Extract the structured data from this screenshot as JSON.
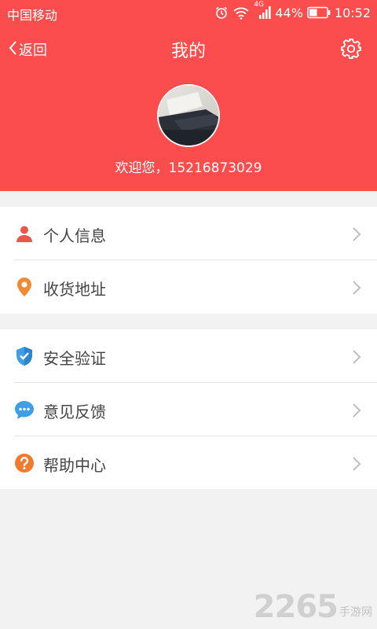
{
  "status_bar": {
    "carrier": "中国移动",
    "network": "4G",
    "battery": "44%",
    "time": "10:52"
  },
  "nav": {
    "back_label": "返回",
    "title": "我的",
    "settings_icon": "gear-icon"
  },
  "profile": {
    "welcome": "欢迎您，15216873029"
  },
  "menu_group_1": [
    {
      "label": "个人信息",
      "icon": "person-icon",
      "color": "#e8574b"
    },
    {
      "label": "收货地址",
      "icon": "location-pin-icon",
      "color": "#f08a33"
    }
  ],
  "menu_group_2": [
    {
      "label": "安全验证",
      "icon": "shield-icon",
      "color": "#3d9fe8"
    },
    {
      "label": "意见反馈",
      "icon": "chat-bubble-icon",
      "color": "#3d9fe8"
    },
    {
      "label": "帮助中心",
      "icon": "question-icon",
      "color": "#f07b2f"
    }
  ],
  "colors": {
    "header_bg": "#fb4d4d",
    "page_bg": "#f2f2f2"
  },
  "watermark": {
    "number": "2265",
    "text": "手游网"
  }
}
